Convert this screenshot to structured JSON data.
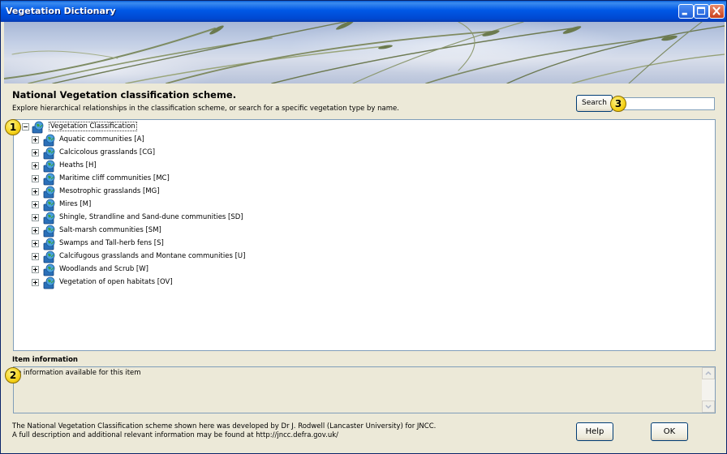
{
  "window": {
    "title": "Vegetation Dictionary"
  },
  "header": {
    "heading": "National Vegetation classification scheme.",
    "subheading": "Explore hierarchical relationships in the classification scheme, or search for a specific vegetation type by name."
  },
  "search": {
    "button_label": "Search",
    "value": ""
  },
  "tree": {
    "root_label": "Vegetation Classification",
    "items": [
      {
        "label": "Aquatic communities [A]"
      },
      {
        "label": "Calcicolous grasslands [CG]"
      },
      {
        "label": "Heaths [H]"
      },
      {
        "label": "Maritime cliff communities [MC]"
      },
      {
        "label": "Mesotrophic grasslands [MG]"
      },
      {
        "label": "Mires [M]"
      },
      {
        "label": "Shingle, Strandline and Sand-dune communities [SD]"
      },
      {
        "label": "Salt-marsh communities [SM]"
      },
      {
        "label": "Swamps and Tall-herb fens [S]"
      },
      {
        "label": "Calcifugous grasslands and Montane communities [U]"
      },
      {
        "label": "Woodlands and Scrub [W]"
      },
      {
        "label": "Vegetation of open habitats [OV]"
      }
    ]
  },
  "info": {
    "label": "Item information",
    "text": "o information available for this item"
  },
  "footer": {
    "credit_line1": "The National Vegetation Classification scheme shown here was developed by Dr J. Rodwell (Lancaster University) for JNCC.",
    "credit_line2": "A full description and additional relevant information may be found at http://jncc.defra.gov.uk/",
    "help_label": "Help",
    "ok_label": "OK"
  },
  "callouts": {
    "one": "1",
    "two": "2",
    "three": "3"
  },
  "icons": {
    "node": "globe-book-icon",
    "expand": "plus-expander-icon",
    "collapse": "minus-expander-icon"
  }
}
